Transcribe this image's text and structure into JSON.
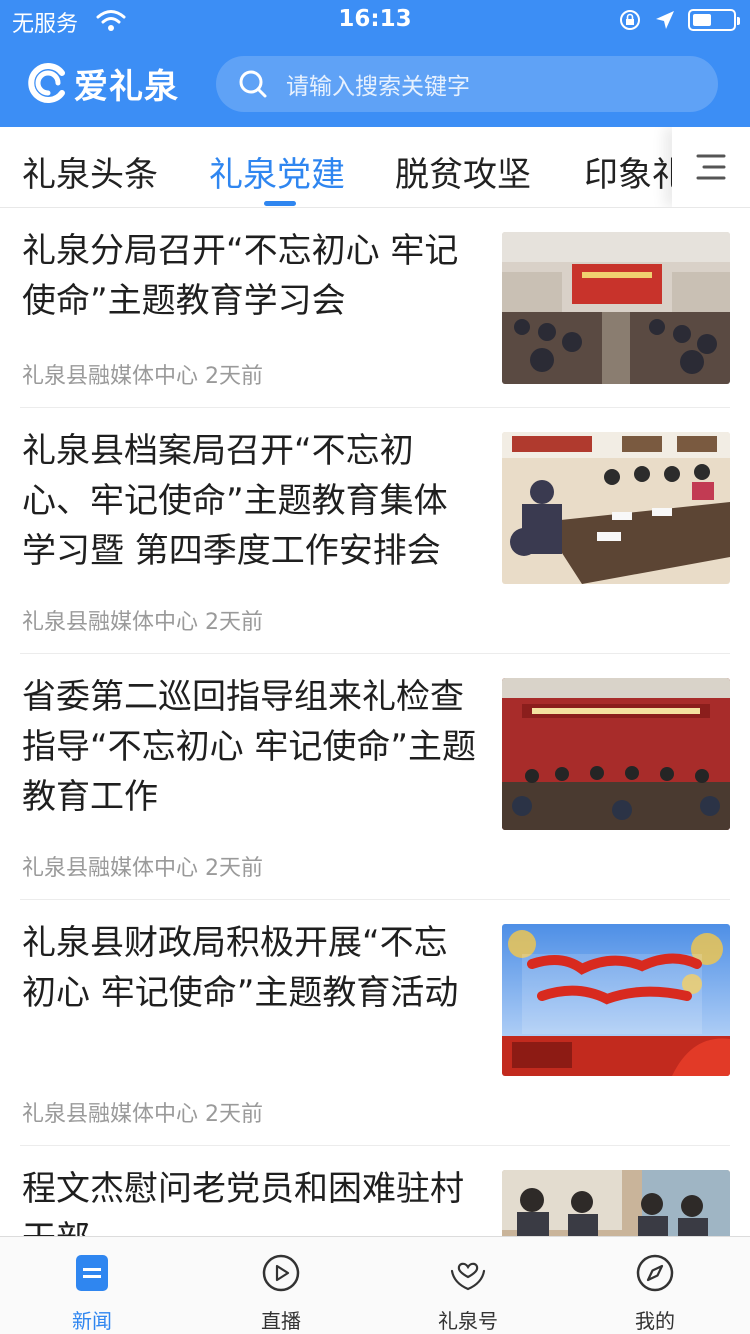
{
  "status_bar": {
    "carrier": "无服务",
    "time": "16:13"
  },
  "app": {
    "logo_text": "爱礼泉",
    "search_placeholder": "请输入搜索关键字",
    "accent_color": "#3c8ef5"
  },
  "tabs": [
    {
      "label": "礼泉头条"
    },
    {
      "label": "礼泉党建",
      "active": true
    },
    {
      "label": "脱贫攻坚"
    },
    {
      "label": "印象礼"
    }
  ],
  "articles": [
    {
      "title": "礼泉分局召开“不忘初心 牢记使命”主题教育学习会",
      "source": "礼泉县融媒体中心",
      "time": "2天前"
    },
    {
      "title": "礼泉县档案局召开“不忘初心、牢记使命”主题教育集体学习暨 第四季度工作安排会",
      "source": "礼泉县融媒体中心",
      "time": "2天前"
    },
    {
      "title": "省委第二巡回指导组来礼检查指导“不忘初心 牢记使命”主题教育工作",
      "source": "礼泉县融媒体中心",
      "time": "2天前"
    },
    {
      "title": "礼泉县财政局积极开展“不忘初心 牢记使命”主题教育活动",
      "source": "礼泉县融媒体中心",
      "time": "2天前"
    },
    {
      "title": "程文杰慰问老党员和困难驻村干部"
    }
  ],
  "bottom_nav": [
    {
      "label": "新闻",
      "icon": "news-icon",
      "active": true
    },
    {
      "label": "直播",
      "icon": "play-icon"
    },
    {
      "label": "礼泉号",
      "icon": "heart-hands-icon"
    },
    {
      "label": "我的",
      "icon": "compass-icon"
    }
  ]
}
